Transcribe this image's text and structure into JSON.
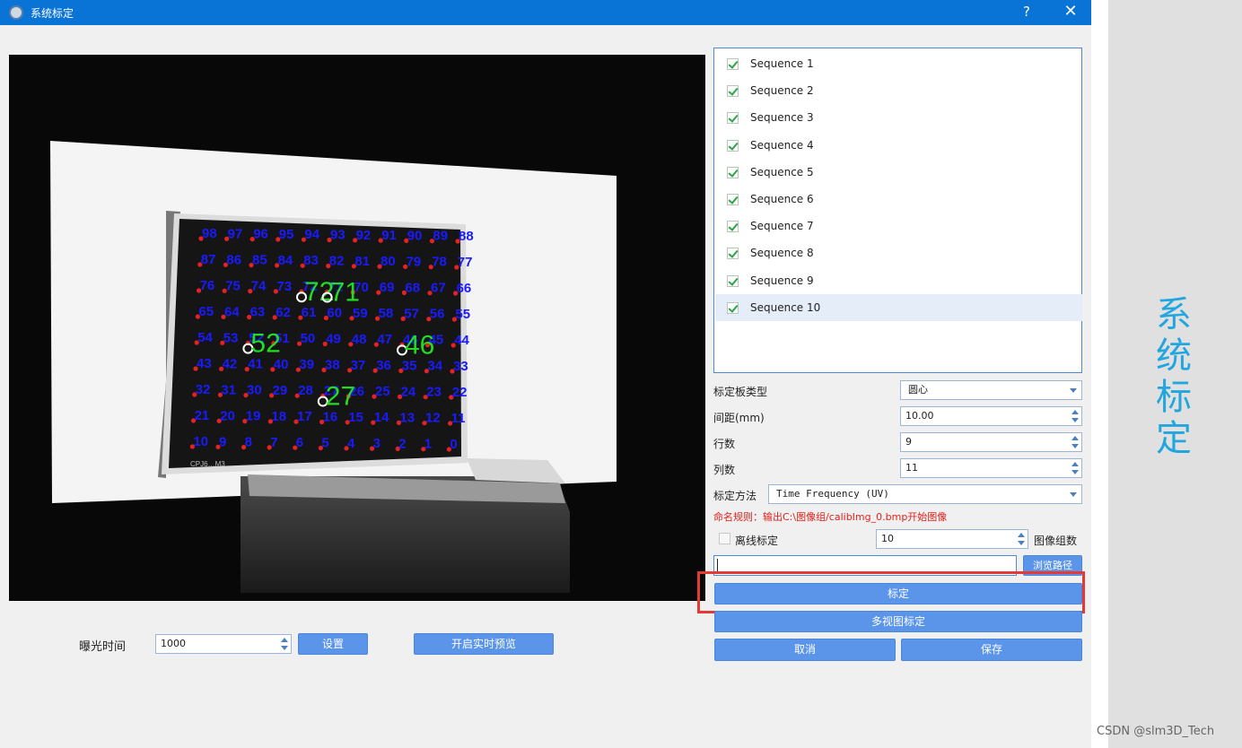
{
  "window": {
    "title": "系统标定",
    "help": "?",
    "close": "✕"
  },
  "camera": {
    "board_label": "CPJ6…M3",
    "dot_numbers": [
      [
        "98",
        "97",
        "96",
        "95",
        "94",
        "93",
        "92",
        "91",
        "90",
        "89",
        "88"
      ],
      [
        "87",
        "86",
        "85",
        "84",
        "83",
        "82",
        "81",
        "80",
        "79",
        "78",
        "77"
      ],
      [
        "76",
        "75",
        "74",
        "73",
        "72",
        "71",
        "70",
        "69",
        "68",
        "67",
        "66"
      ],
      [
        "65",
        "64",
        "63",
        "62",
        "61",
        "60",
        "59",
        "58",
        "57",
        "56",
        "55"
      ],
      [
        "54",
        "53",
        "52",
        "51",
        "50",
        "49",
        "48",
        "47",
        "46",
        "45",
        "44"
      ],
      [
        "43",
        "42",
        "41",
        "40",
        "39",
        "38",
        "37",
        "36",
        "35",
        "34",
        "33"
      ],
      [
        "32",
        "31",
        "30",
        "29",
        "28",
        "27",
        "26",
        "25",
        "24",
        "23",
        "22"
      ],
      [
        "21",
        "20",
        "19",
        "18",
        "17",
        "16",
        "15",
        "14",
        "13",
        "12",
        "11"
      ],
      [
        "10",
        "9",
        "8",
        "7",
        "6",
        "5",
        "4",
        "3",
        "2",
        "1",
        "0"
      ]
    ],
    "marker_labels": [
      "72",
      "71",
      "52",
      "46",
      "27"
    ],
    "dot_color": "#e52222",
    "number_color": "#1a1aff",
    "marker_color": "#22dd22"
  },
  "exposure": {
    "label": "曝光时间",
    "value": "1000",
    "set_label": "设置",
    "preview_label": "开启实时预览"
  },
  "sequences": [
    "Sequence 1",
    "Sequence 2",
    "Sequence 3",
    "Sequence 4",
    "Sequence 5",
    "Sequence 6",
    "Sequence 7",
    "Sequence 8",
    "Sequence 9",
    "Sequence 10"
  ],
  "selected_sequence": 10,
  "form": {
    "board_type_label": "标定板类型",
    "board_type_value": "圆心",
    "spacing_label": "间距(mm)",
    "spacing_value": "10.00",
    "rows_label": "行数",
    "rows_value": "9",
    "cols_label": "列数",
    "cols_value": "11",
    "method_label": "标定方法",
    "method_value": "Time Frequency (UV)",
    "naming_rule": "命名规则：输出C:\\图像组/calibImg_0.bmp开始图像",
    "offline_label": "离线标定",
    "offline_count": "10",
    "image_group_label": "图像组数",
    "path_value": "",
    "browse_label": "浏览路径"
  },
  "buttons": {
    "calibrate": "标定",
    "multi_calibrate": "多视图标定",
    "cancel": "取消",
    "save": "保存"
  },
  "side_banner": [
    "系",
    "统",
    "标",
    "定"
  ],
  "watermark": "CSDN @slm3D_Tech",
  "colors": {
    "titlebar": "#0a74d6",
    "button": "#5a95ea",
    "highlight": "#e53935",
    "accent": "#22a6e0"
  }
}
